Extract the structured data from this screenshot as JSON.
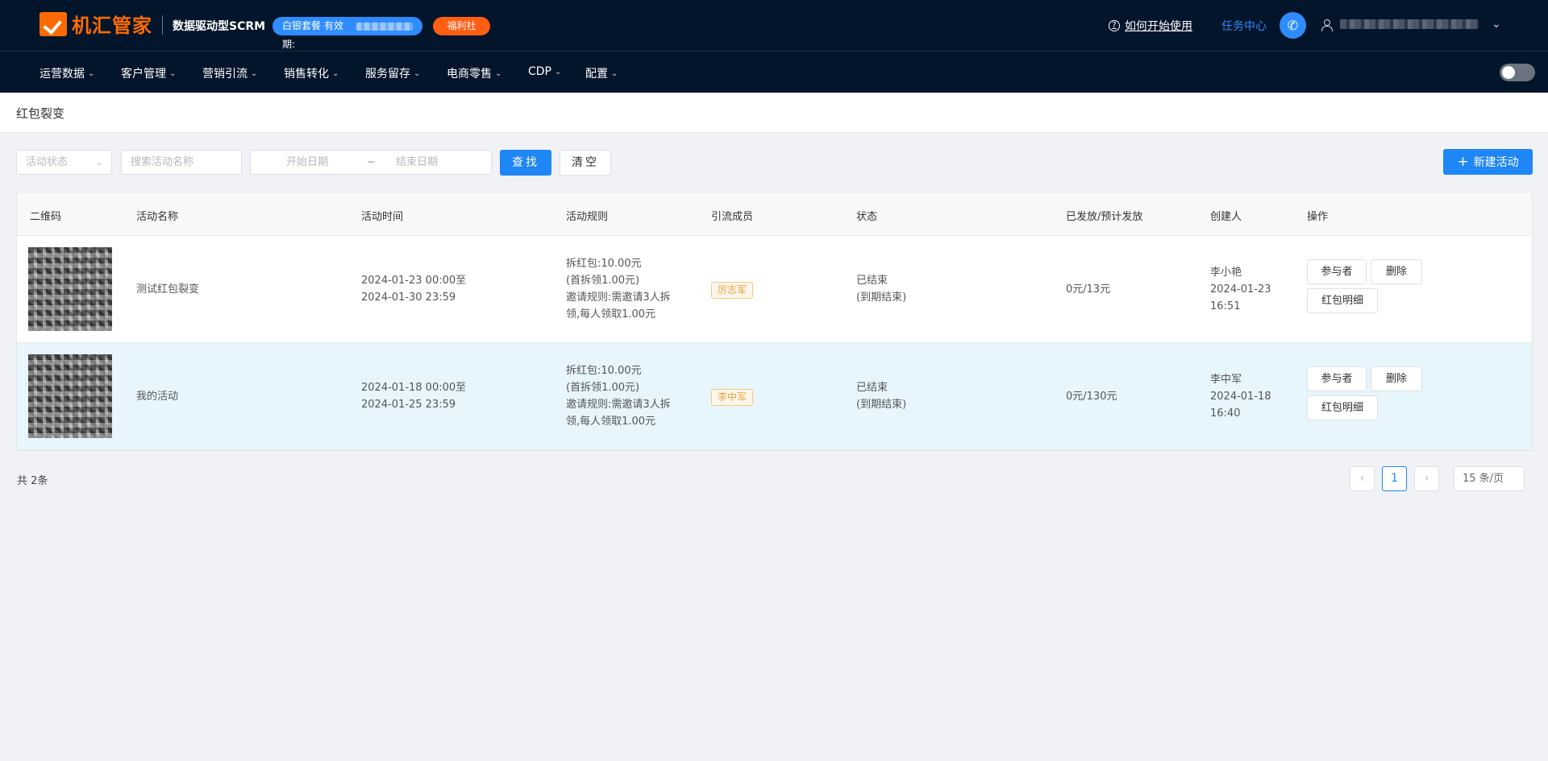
{
  "header": {
    "brand": "机汇管家",
    "slogan": "数据驱动型SCRM",
    "plan_badge": "白银套餐 有效期:",
    "welfare_badge": "福利社",
    "help_link": "如何开始使用",
    "task_center": "任务中心"
  },
  "nav": {
    "items": [
      "运营数据",
      "客户管理",
      "营销引流",
      "销售转化",
      "服务留存",
      "电商零售",
      "CDP",
      "配置"
    ]
  },
  "page": {
    "title": "红包裂变"
  },
  "filters": {
    "status_placeholder": "活动状态",
    "search_placeholder": "搜索活动名称",
    "start_date_placeholder": "开始日期",
    "range_separator": "~",
    "end_date_placeholder": "结束日期",
    "search_button": "查找",
    "clear_button": "清空",
    "new_button": "新建活动"
  },
  "table": {
    "columns": [
      "二维码",
      "活动名称",
      "活动时间",
      "活动规则",
      "引流成员",
      "状态",
      "已发放/预计发放",
      "创建人",
      "操作"
    ],
    "rows": [
      {
        "name": "测试红包裂变",
        "time_start": "2024-01-23 00:00至",
        "time_end": "2024-01-30 23:59",
        "rule_line1": "拆红包:10.00元",
        "rule_line2": "(首拆领1.00元)",
        "rule_line3": "邀请规则:需邀请3人拆",
        "rule_line4": "领,每人领取1.00元",
        "member": "厉志军",
        "status_line1": "已结束",
        "status_line2": "(到期结束)",
        "issued": "0元/13元",
        "creator": "李小艳",
        "created_date": "2024-01-23",
        "created_time": "16:51",
        "ops": [
          "参与者",
          "删除",
          "红包明细"
        ]
      },
      {
        "name": "我的活动",
        "time_start": "2024-01-18 00:00至",
        "time_end": "2024-01-25 23:59",
        "rule_line1": "拆红包:10.00元",
        "rule_line2": "(首拆领1.00元)",
        "rule_line3": "邀请规则:需邀请3人拆",
        "rule_line4": "领,每人领取1.00元",
        "member": "李中军",
        "status_line1": "已结束",
        "status_line2": "(到期结束)",
        "issued": "0元/130元",
        "creator": "李中军",
        "created_date": "2024-01-18",
        "created_time": "16:40",
        "ops": [
          "参与者",
          "删除",
          "红包明细"
        ]
      }
    ]
  },
  "pagination": {
    "total": "共 2条",
    "current_page": "1",
    "page_size": "15 条/页"
  },
  "icons": {
    "help": "question-circle-icon",
    "phone": "phone-icon",
    "user": "user-icon",
    "chevron": "chevron-down-icon",
    "plus": "plus-icon",
    "prev": "chevron-left-icon",
    "next": "chevron-right-icon"
  },
  "colors": {
    "header_bg": "#03152b",
    "brand_orange": "#ff6a00",
    "primary_blue": "#1f86f5",
    "row_highlight": "#e6f6fc",
    "tag_orange": "#e6a23c"
  }
}
